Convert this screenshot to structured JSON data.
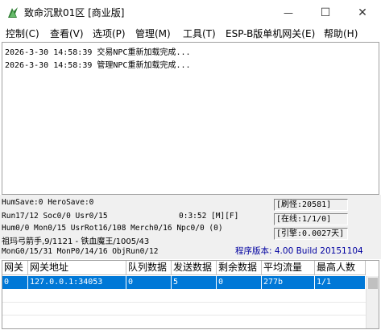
{
  "window": {
    "title": "致命沉默01区 [商业版]",
    "minimize_glyph": "—",
    "maximize_glyph": "☐",
    "close_glyph": "✕"
  },
  "menu": {
    "items": [
      {
        "label": "控制(C)"
      },
      {
        "label": "查看(V)"
      },
      {
        "label": "选项(P)"
      },
      {
        "label": "管理(M)"
      },
      {
        "label": "工具(T)"
      },
      {
        "label": "ESP-B版单机网关(E)"
      },
      {
        "label": "帮助(H)"
      }
    ]
  },
  "log": {
    "lines": [
      "2026-3-30 14:58:39 交易NPC重新加载完成...",
      "2026-3-30 14:58:39 管理NPC重新加载完成..."
    ]
  },
  "status": {
    "line1": "HumSave:0 HeroSave:0",
    "line2": "Run17/12 Soc0/0 Usr0/15",
    "time": "0:3:52 [M][F]",
    "line3": "Hum0/0 Mon0/15 UsrRot16/108 Merch0/16 Npc0/0 (0)",
    "line4": "祖玛弓箭手,9/1121 - 铁血魔王/1005/43",
    "line5": "MonG0/15/31 MonP0/14/16 ObjRun0/12",
    "refresh": "[刷怪:20581]",
    "online": "[在线:1/1/0]",
    "engine": "[引擎:0.0027天]",
    "version": "程序版本: 4.00 Build 20151104"
  },
  "grid": {
    "headers": [
      "网关",
      "网关地址",
      "队列数据",
      "发送数据",
      "剩余数据",
      "平均流量",
      "最高人数"
    ],
    "rows": [
      [
        "0",
        "127.0.0.1:34053",
        "0",
        "5",
        "0",
        "277b",
        "1/1"
      ]
    ]
  },
  "colors": {
    "selection": "#0078d7",
    "version_text": "#0000a0"
  }
}
